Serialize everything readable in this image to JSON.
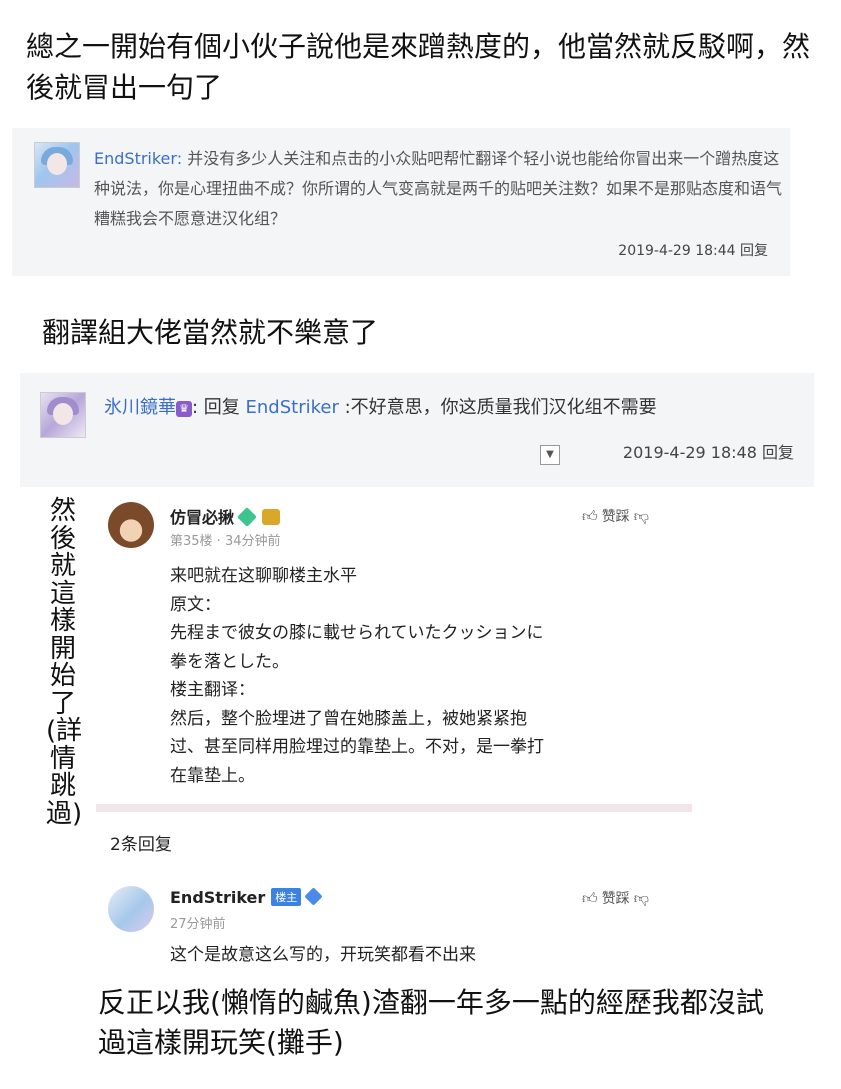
{
  "captions": {
    "top": "總之一開始有個小伙子說他是來蹭熱度的，他當然就反駁啊，然後就冒出一句了",
    "middle": "翻譯組大佬當然就不樂意了",
    "vertical": "然後就這樣開始了(詳情跳過)",
    "bottom": "反正以我(懶惰的鹹魚)渣翻一年多一點的經歷我都沒試過這樣開玩笑(攤手)"
  },
  "post1": {
    "username": "EndStriker:",
    "text": "并没有多少人关注和点击的小众贴吧帮忙翻译个轻小说也能给你冒出来一个蹭热度这种说法，你是心理扭曲不成？你所谓的人气变高就是两千的贴吧关注数？如果不是那贴态度和语气糟糕我会不愿意进汉化组？",
    "time": "2019-4-29 18:44 回复"
  },
  "post2": {
    "username": "氷川鏡華",
    "reply_prefix": ": 回复 ",
    "reply_to": "EndStriker",
    "text": " :不好意思，你这质量我们汉化组不需要",
    "time": "2019-4-29 18:48 回复"
  },
  "comment1": {
    "name": "仿冒必揪",
    "meta": "第35楼 · 34分钟前",
    "vote_label": "赞踩",
    "lines": [
      "来吧就在这聊聊楼主水平",
      "原文：",
      "先程まで彼女の膝に載せられていたクッションに",
      "拳を落とした。",
      "楼主翻译：",
      "然后，整个脸埋进了曾在她膝盖上，被她紧紧抱",
      "过、甚至同样用脸埋过的靠垫上。不对，是一拳打",
      "在靠垫上。"
    ]
  },
  "replies_count": "2条回复",
  "comment2": {
    "name": "EndStriker",
    "owner_tag": "楼主",
    "meta": "27分钟前",
    "vote_label": "赞踩",
    "text": "这个是故意这么写的，开玩笑都看不出来"
  }
}
